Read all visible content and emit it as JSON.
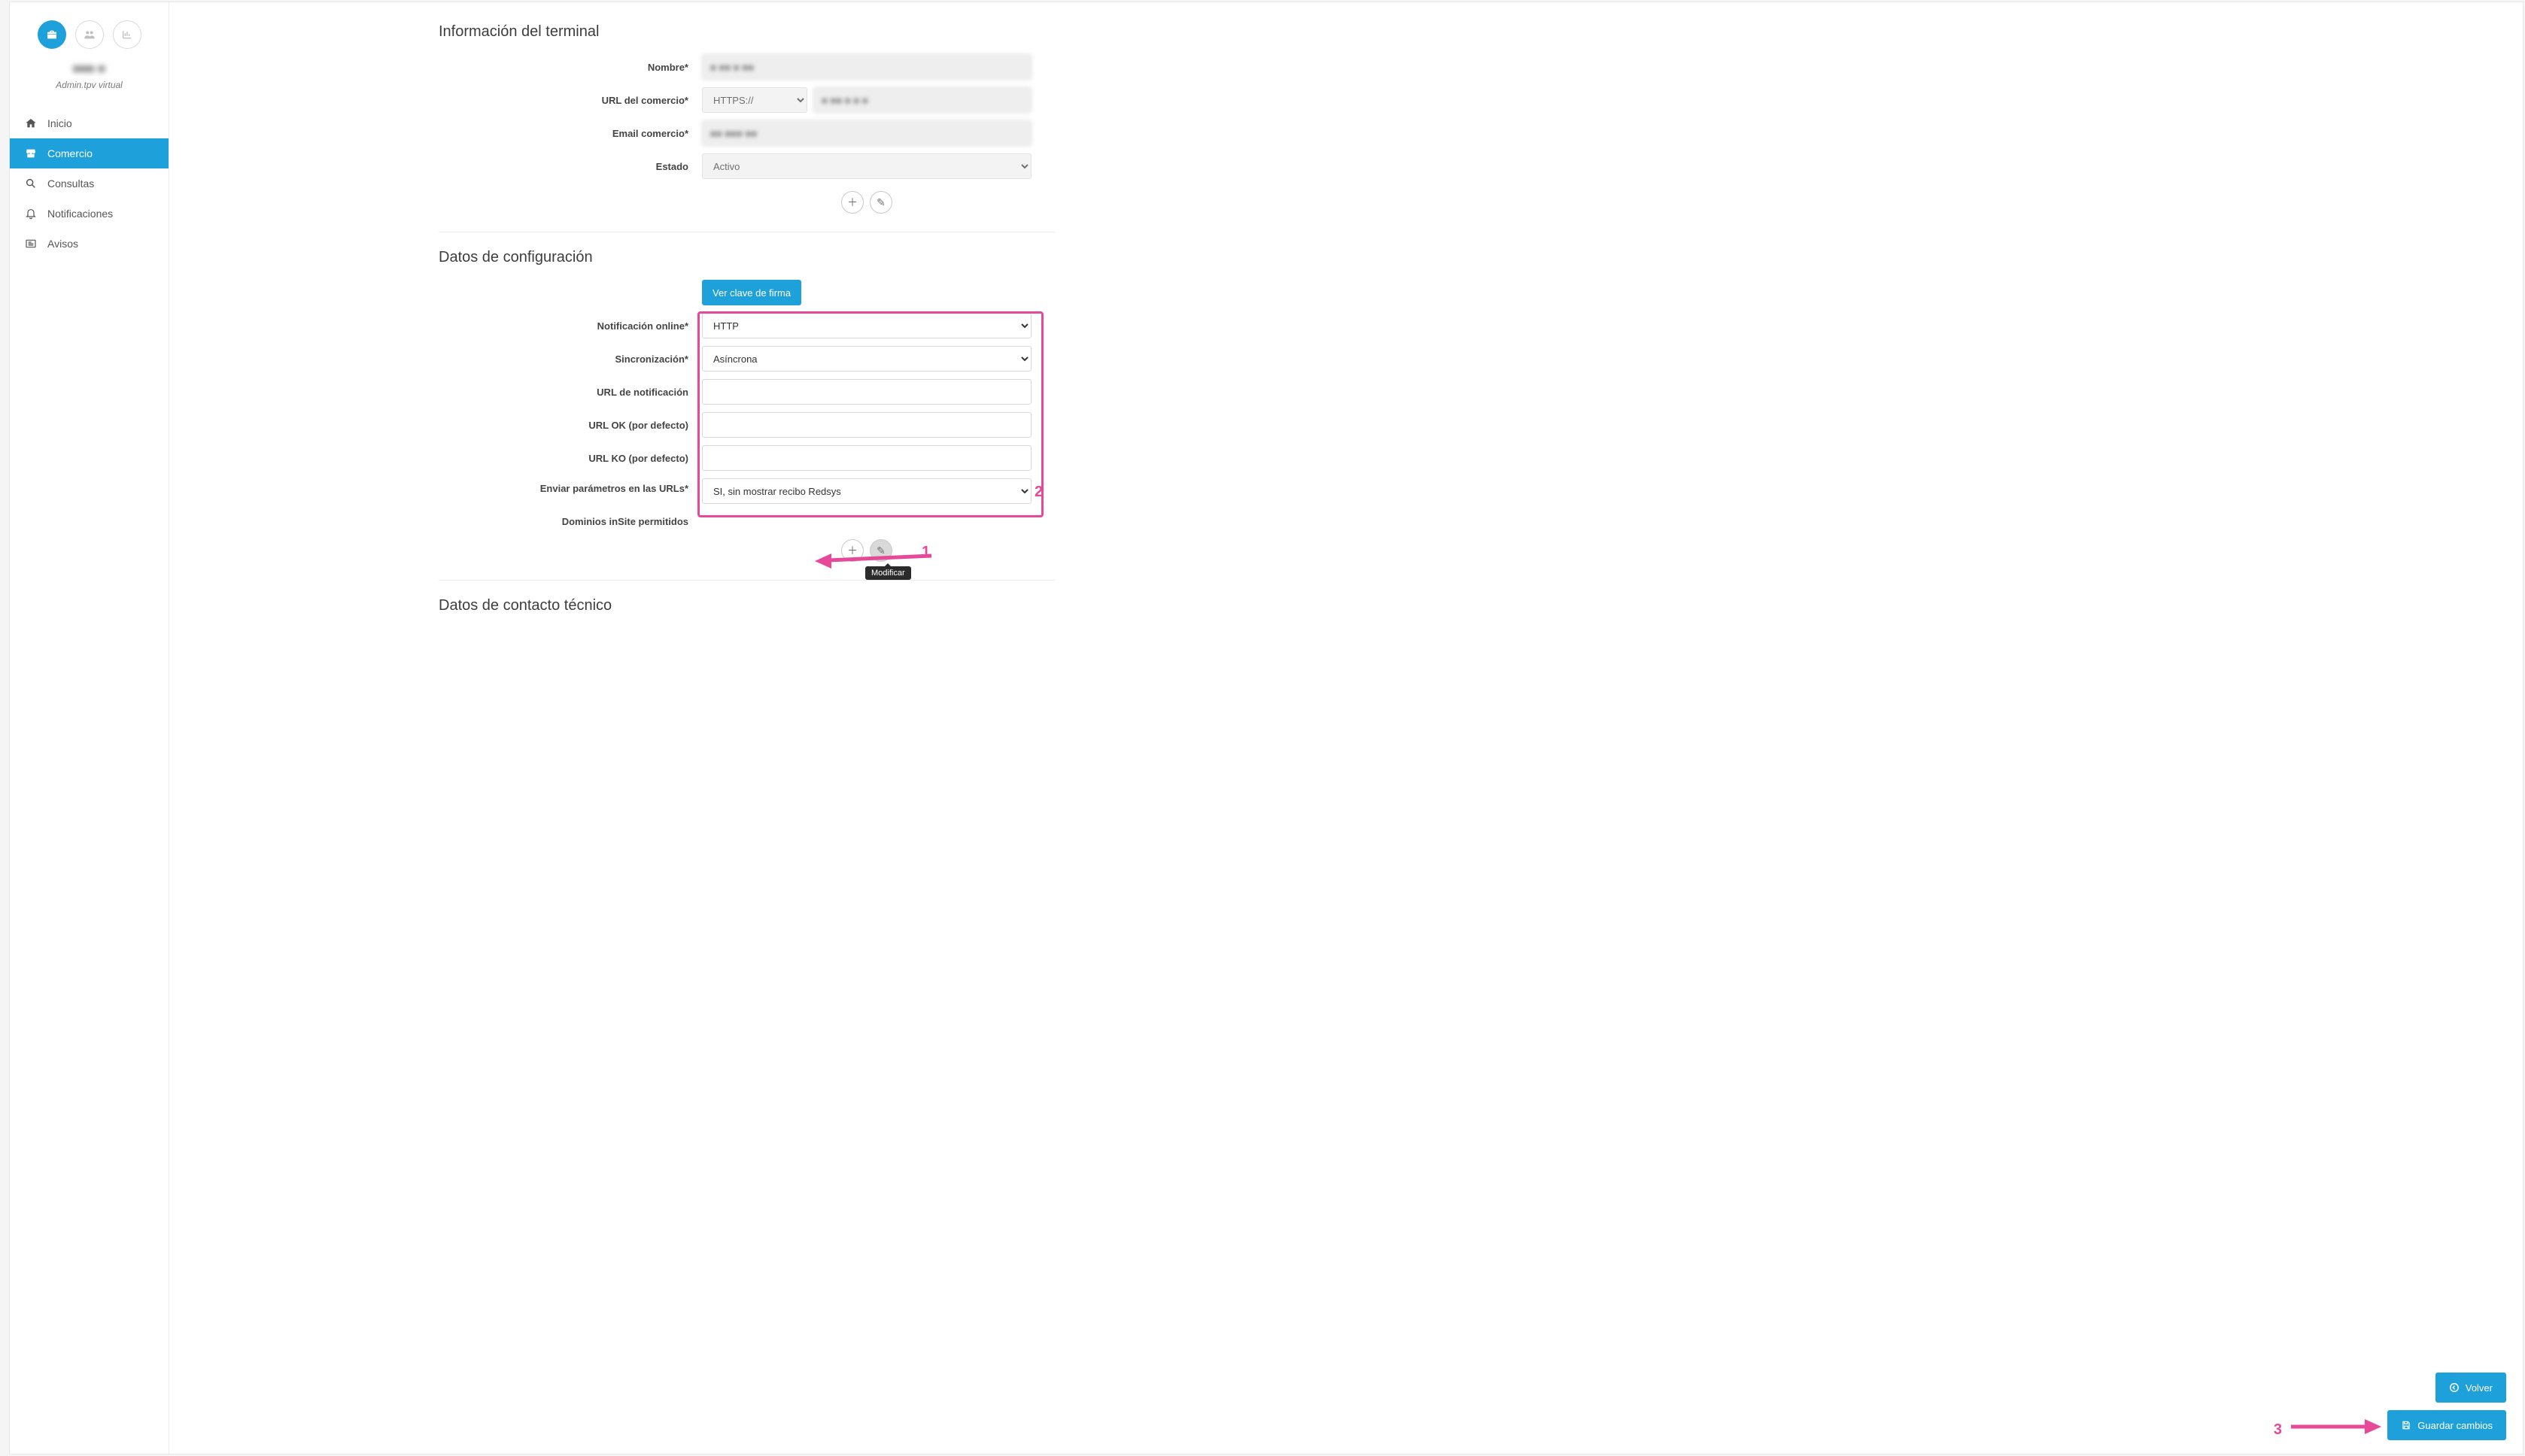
{
  "sidebar": {
    "merchant_name": "■■■ ■",
    "role_label": "Admin.tpv virtual",
    "items": [
      {
        "label": "Inicio"
      },
      {
        "label": "Comercio"
      },
      {
        "label": "Consultas"
      },
      {
        "label": "Notificaciones"
      },
      {
        "label": "Avisos"
      }
    ]
  },
  "sections": {
    "terminal_info_title": "Información del terminal",
    "config_title": "Datos de configuración",
    "contact_title": "Datos de contacto técnico"
  },
  "terminal": {
    "labels": {
      "nombre": "Nombre*",
      "url_comercio": "URL del comercio*",
      "email_comercio": "Email comercio*",
      "estado": "Estado"
    },
    "values": {
      "nombre": "■ ■■ ■ ■■",
      "url_protocol": "HTTPS://",
      "url_value": "■ ■■ ■ ■ ■",
      "email": "■■ ■■■ ■■",
      "estado": "Activo"
    }
  },
  "config": {
    "ver_clave_btn": "Ver clave de firma",
    "labels": {
      "notif_online": "Notificación online*",
      "sincronizacion": "Sincronización*",
      "url_notif": "URL de notificación",
      "url_ok": "URL OK (por defecto)",
      "url_ko": "URL KO (por defecto)",
      "enviar_params": "Enviar parámetros en las URLs*",
      "dominios_insite": "Dominios inSite permitidos"
    },
    "values": {
      "notif_online": "HTTP",
      "sincronizacion": "Asíncrona",
      "url_notif": "",
      "url_ok": "",
      "url_ko": "",
      "enviar_params": "SI, sin mostrar recibo Redsys"
    },
    "tooltip_modificar": "Modificar"
  },
  "buttons": {
    "volver": "Volver",
    "guardar": "Guardar cambios"
  },
  "annotations": {
    "n1": "1",
    "n2": "2",
    "n3": "3"
  }
}
